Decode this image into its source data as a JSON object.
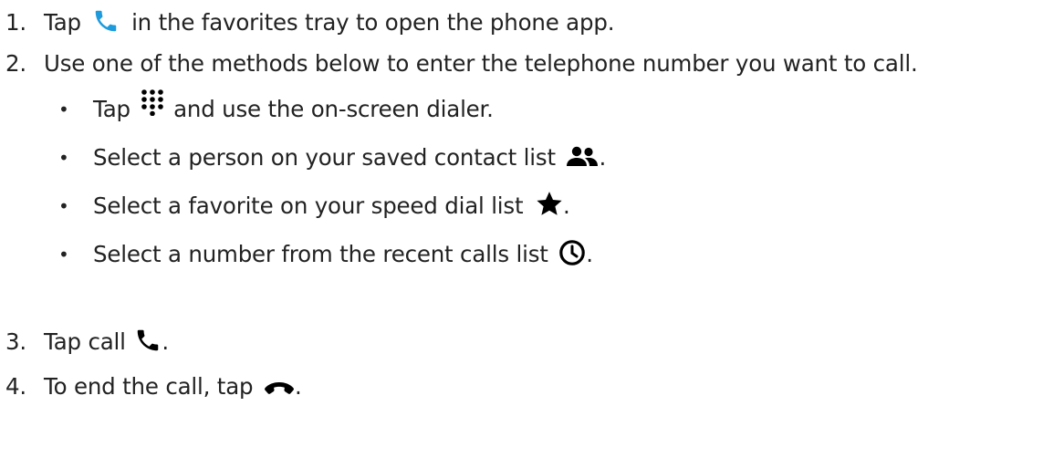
{
  "steps": [
    {
      "number": "1.",
      "text_before": "Tap",
      "icon": "phone-blue-icon",
      "text_after": "in the favorites tray to open the phone app."
    },
    {
      "number": "2.",
      "text": "Use one of the methods below to enter the telephone number you want to call."
    },
    {
      "number": "3.",
      "text_before": "Tap call",
      "icon": "phone-call-icon",
      "text_after": "."
    },
    {
      "number": "4.",
      "text_before": "To end the call, tap",
      "icon": "end-call-icon",
      "text_after": "."
    }
  ],
  "bullets": [
    {
      "text_before": "Tap",
      "icon": "dialpad-icon",
      "text_after": "and use the on-screen dialer."
    },
    {
      "text_before": "Select a person on your saved contact list",
      "icon": "contacts-icon",
      "text_after": "."
    },
    {
      "text_before": "Select a favorite on your speed dial list",
      "icon": "star-icon",
      "text_after": "."
    },
    {
      "text_before": "Select a number from the recent calls list",
      "icon": "clock-icon",
      "text_after": "."
    }
  ],
  "bullet_glyph": "•",
  "colors": {
    "text": "#222222",
    "phone_blue": "#1e9bdc",
    "icon_dark": "#000000"
  }
}
